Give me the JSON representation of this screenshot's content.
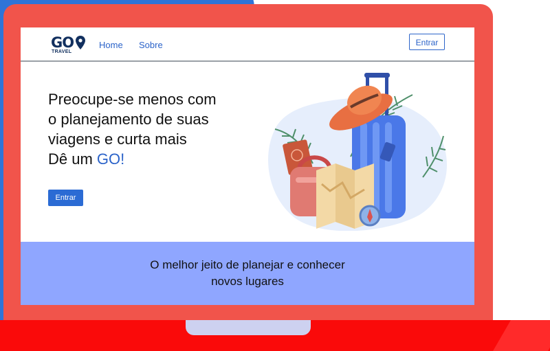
{
  "logo": {
    "text": "GO",
    "subtext": "TRAVEL"
  },
  "nav": {
    "links": [
      "Home",
      "Sobre"
    ],
    "login_label": "Entrar"
  },
  "hero": {
    "lines": [
      "Preocupe-se menos com",
      "o planejamento de suas",
      "viagens e curta mais"
    ],
    "last_line_prefix": "Dê um ",
    "last_line_accent": "GO!",
    "cta_label": "Entrar"
  },
  "banner": {
    "lines": [
      "O melhor jeito de planejar e conhecer",
      "novos lugares"
    ]
  },
  "colors": {
    "accent": "#2b63c9",
    "banner": "#8fa6ff",
    "frame": "#f1544b",
    "backdrop_blue": "#2f74d8",
    "base_red": "#fa0a0a"
  },
  "icons": [
    "map-pin-icon",
    "hat-icon",
    "suitcase-icon",
    "bag-icon",
    "passport-icon",
    "map-icon",
    "compass-icon",
    "palm-leaf-icon"
  ]
}
